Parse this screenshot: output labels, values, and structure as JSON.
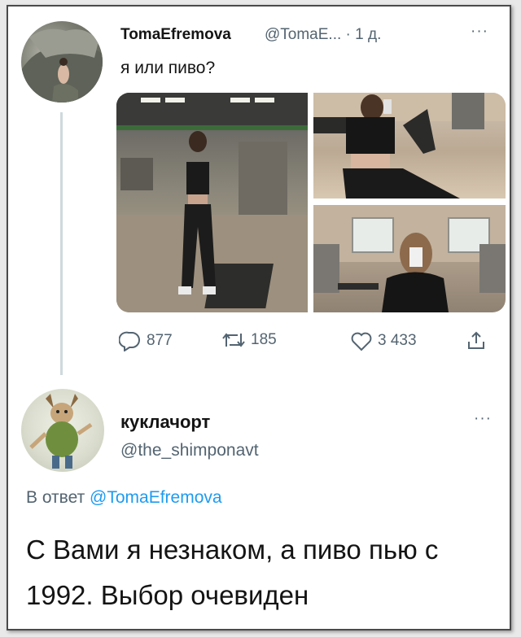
{
  "tweet": {
    "display_name": "TomaEfremova",
    "handle": "@TomaE...",
    "separator": "·",
    "time": "1 д.",
    "more": "···",
    "text": "я или пиво?",
    "actions": {
      "replies": "877",
      "retweets": "185",
      "likes": "3 433"
    }
  },
  "reply": {
    "display_name": "куклачорт",
    "handle": "@the_shimponavt",
    "more": "···",
    "in_reply_prefix": "В ответ",
    "in_reply_handle": "@TomaEfremova",
    "text": "С Вами я незнаком, а пиво пью с 1992. Выбор очевиден"
  },
  "colors": {
    "link": "#1d9bf0",
    "muted": "#536471",
    "thread_line": "#cfd9de"
  },
  "icons": [
    "reply-icon",
    "retweet-icon",
    "like-icon",
    "share-icon",
    "more-icon"
  ]
}
